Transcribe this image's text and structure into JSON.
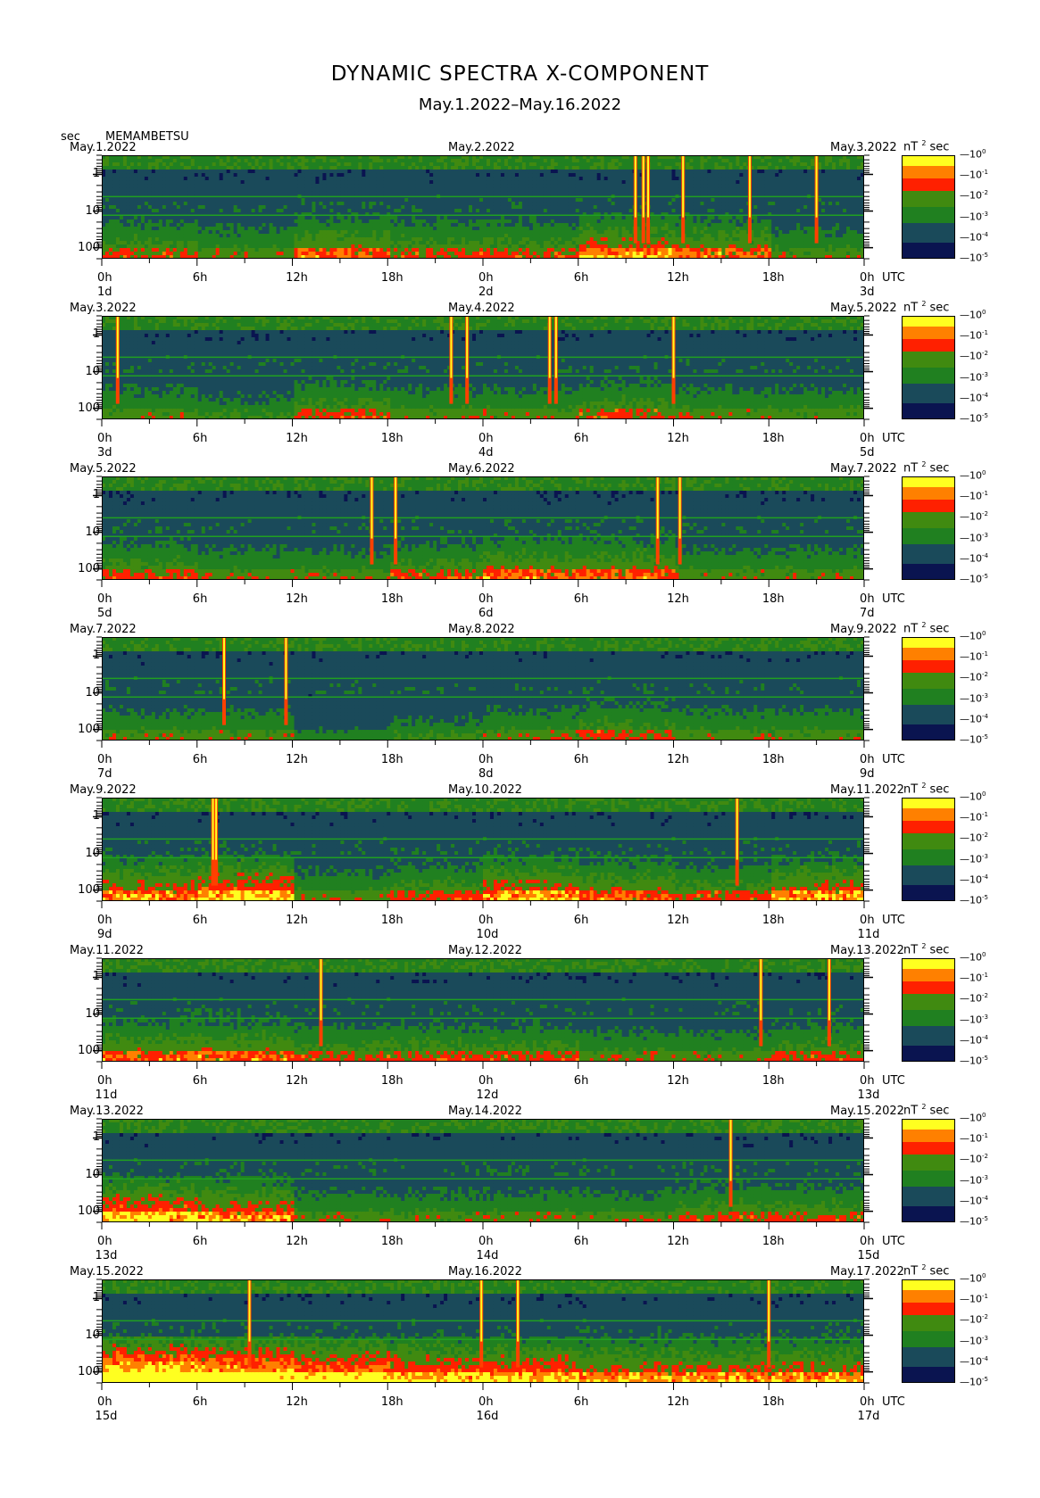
{
  "title": "DYNAMIC SPECTRA X-COMPONENT",
  "subtitle": "May.1.2022–May.16.2022",
  "y_unit": "sec",
  "station": "MEMAMBETSU",
  "colorbar_unit": "nT",
  "colorbar_unit_exp": "2",
  "colorbar_unit_suffix": "sec",
  "utc_label": "UTC",
  "colors": {
    "high": "#ffff20",
    "mid_high": "#ff2000",
    "mid": "#208020",
    "low": "#102060",
    "lowest": "#000008"
  },
  "colorbar_ticks": [
    {
      "base": "10",
      "exp": "0"
    },
    {
      "base": "10",
      "exp": "-1"
    },
    {
      "base": "10",
      "exp": "-2"
    },
    {
      "base": "10",
      "exp": "-3"
    },
    {
      "base": "10",
      "exp": "-4"
    },
    {
      "base": "10",
      "exp": "-5"
    }
  ],
  "y_ticks": [
    "1",
    "10",
    "100"
  ],
  "x_ticks": [
    "0h",
    "6h",
    "12h",
    "18h",
    "0h",
    "6h",
    "12h",
    "18h",
    "0h"
  ],
  "chart_data": {
    "type": "heatmap",
    "title": "DYNAMIC SPECTRA X-COMPONENT",
    "ylabel": "sec",
    "y_scale": "log",
    "y_range": [
      0.3,
      200
    ],
    "color_scale": "log",
    "color_range": [
      1e-05,
      1
    ],
    "panels": [
      {
        "left": "May.1.2022",
        "mid": "May.2.2022",
        "right": "May.3.2022",
        "day_left": "1d",
        "day_mid": "2d",
        "day_right": "3d",
        "spikes_h": [
          33.6,
          34.1,
          34.4,
          36.6,
          40.8,
          45.0
        ],
        "activity": [
          0.35,
          0.3,
          0.4,
          0.35,
          0.35,
          0.45,
          0.4,
          0.3
        ]
      },
      {
        "left": "May.3.2022",
        "mid": "May.4.2022",
        "right": "May.5.2022",
        "day_left": "3d",
        "day_mid": "4d",
        "day_right": "5d",
        "spikes_h": [
          1.0,
          22.0,
          23.0,
          28.2,
          28.6,
          36.0
        ],
        "activity": [
          0.3,
          0.25,
          0.35,
          0.3,
          0.3,
          0.35,
          0.3,
          0.3
        ]
      },
      {
        "left": "May.5.2022",
        "mid": "May.6.2022",
        "right": "May.7.2022",
        "day_left": "5d",
        "day_mid": "6d",
        "day_right": "7d",
        "spikes_h": [
          17.0,
          18.5,
          35.0,
          36.4
        ],
        "activity": [
          0.35,
          0.3,
          0.3,
          0.35,
          0.4,
          0.4,
          0.3,
          0.3
        ]
      },
      {
        "left": "May.7.2022",
        "mid": "May.8.2022",
        "right": "May.9.2022",
        "day_left": "7d",
        "day_mid": "8d",
        "day_right": "9d",
        "spikes_h": [
          7.7,
          11.6
        ],
        "activity": [
          0.3,
          0.3,
          0.2,
          0.25,
          0.3,
          0.35,
          0.3,
          0.3
        ]
      },
      {
        "left": "May.9.2022",
        "mid": "May.10.2022",
        "right": "May.11.2022",
        "day_left": "9d",
        "day_mid": "10d",
        "day_right": "11d",
        "spikes_h": [
          7.0,
          7.2,
          40.0
        ],
        "activity": [
          0.45,
          0.5,
          0.3,
          0.35,
          0.45,
          0.4,
          0.35,
          0.45
        ]
      },
      {
        "left": "May.11.2022",
        "mid": "May.12.2022",
        "right": "May.13.2022",
        "day_left": "11d",
        "day_mid": "12d",
        "day_right": "13d",
        "spikes_h": [
          13.8,
          41.5,
          45.8
        ],
        "activity": [
          0.4,
          0.4,
          0.35,
          0.35,
          0.35,
          0.3,
          0.3,
          0.35
        ]
      },
      {
        "left": "May.13.2022",
        "mid": "May.14.2022",
        "right": "May.15.2022",
        "day_left": "13d",
        "day_mid": "14d",
        "day_right": "15d",
        "spikes_h": [
          39.6
        ],
        "activity": [
          0.5,
          0.45,
          0.3,
          0.3,
          0.3,
          0.3,
          0.35,
          0.35
        ]
      },
      {
        "left": "May.15.2022",
        "mid": "May.16.2022",
        "right": "May.17.2022",
        "day_left": "15d",
        "day_mid": "16d",
        "day_right": "17d",
        "spikes_h": [
          9.3,
          23.9,
          26.2,
          42.0
        ],
        "activity": [
          0.65,
          0.6,
          0.55,
          0.5,
          0.5,
          0.45,
          0.45,
          0.45
        ]
      }
    ]
  }
}
